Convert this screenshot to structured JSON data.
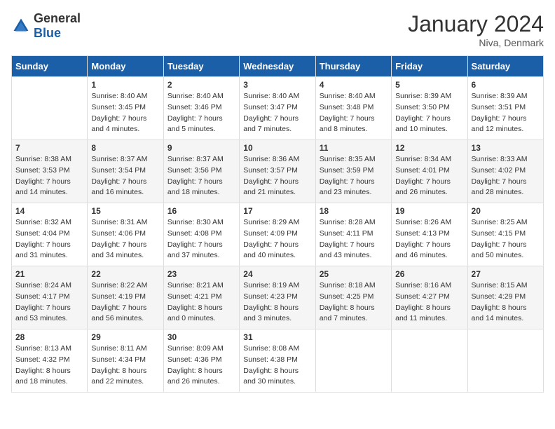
{
  "header": {
    "logo": {
      "general": "General",
      "blue": "Blue"
    },
    "title": "January 2024",
    "location": "Niva, Denmark"
  },
  "days_of_week": [
    "Sunday",
    "Monday",
    "Tuesday",
    "Wednesday",
    "Thursday",
    "Friday",
    "Saturday"
  ],
  "weeks": [
    [
      {
        "day": "",
        "sunrise": "",
        "sunset": "",
        "daylight": ""
      },
      {
        "day": "1",
        "sunrise": "Sunrise: 8:40 AM",
        "sunset": "Sunset: 3:45 PM",
        "daylight": "Daylight: 7 hours and 4 minutes."
      },
      {
        "day": "2",
        "sunrise": "Sunrise: 8:40 AM",
        "sunset": "Sunset: 3:46 PM",
        "daylight": "Daylight: 7 hours and 5 minutes."
      },
      {
        "day": "3",
        "sunrise": "Sunrise: 8:40 AM",
        "sunset": "Sunset: 3:47 PM",
        "daylight": "Daylight: 7 hours and 7 minutes."
      },
      {
        "day": "4",
        "sunrise": "Sunrise: 8:40 AM",
        "sunset": "Sunset: 3:48 PM",
        "daylight": "Daylight: 7 hours and 8 minutes."
      },
      {
        "day": "5",
        "sunrise": "Sunrise: 8:39 AM",
        "sunset": "Sunset: 3:50 PM",
        "daylight": "Daylight: 7 hours and 10 minutes."
      },
      {
        "day": "6",
        "sunrise": "Sunrise: 8:39 AM",
        "sunset": "Sunset: 3:51 PM",
        "daylight": "Daylight: 7 hours and 12 minutes."
      }
    ],
    [
      {
        "day": "7",
        "sunrise": "Sunrise: 8:38 AM",
        "sunset": "Sunset: 3:53 PM",
        "daylight": "Daylight: 7 hours and 14 minutes."
      },
      {
        "day": "8",
        "sunrise": "Sunrise: 8:37 AM",
        "sunset": "Sunset: 3:54 PM",
        "daylight": "Daylight: 7 hours and 16 minutes."
      },
      {
        "day": "9",
        "sunrise": "Sunrise: 8:37 AM",
        "sunset": "Sunset: 3:56 PM",
        "daylight": "Daylight: 7 hours and 18 minutes."
      },
      {
        "day": "10",
        "sunrise": "Sunrise: 8:36 AM",
        "sunset": "Sunset: 3:57 PM",
        "daylight": "Daylight: 7 hours and 21 minutes."
      },
      {
        "day": "11",
        "sunrise": "Sunrise: 8:35 AM",
        "sunset": "Sunset: 3:59 PM",
        "daylight": "Daylight: 7 hours and 23 minutes."
      },
      {
        "day": "12",
        "sunrise": "Sunrise: 8:34 AM",
        "sunset": "Sunset: 4:01 PM",
        "daylight": "Daylight: 7 hours and 26 minutes."
      },
      {
        "day": "13",
        "sunrise": "Sunrise: 8:33 AM",
        "sunset": "Sunset: 4:02 PM",
        "daylight": "Daylight: 7 hours and 28 minutes."
      }
    ],
    [
      {
        "day": "14",
        "sunrise": "Sunrise: 8:32 AM",
        "sunset": "Sunset: 4:04 PM",
        "daylight": "Daylight: 7 hours and 31 minutes."
      },
      {
        "day": "15",
        "sunrise": "Sunrise: 8:31 AM",
        "sunset": "Sunset: 4:06 PM",
        "daylight": "Daylight: 7 hours and 34 minutes."
      },
      {
        "day": "16",
        "sunrise": "Sunrise: 8:30 AM",
        "sunset": "Sunset: 4:08 PM",
        "daylight": "Daylight: 7 hours and 37 minutes."
      },
      {
        "day": "17",
        "sunrise": "Sunrise: 8:29 AM",
        "sunset": "Sunset: 4:09 PM",
        "daylight": "Daylight: 7 hours and 40 minutes."
      },
      {
        "day": "18",
        "sunrise": "Sunrise: 8:28 AM",
        "sunset": "Sunset: 4:11 PM",
        "daylight": "Daylight: 7 hours and 43 minutes."
      },
      {
        "day": "19",
        "sunrise": "Sunrise: 8:26 AM",
        "sunset": "Sunset: 4:13 PM",
        "daylight": "Daylight: 7 hours and 46 minutes."
      },
      {
        "day": "20",
        "sunrise": "Sunrise: 8:25 AM",
        "sunset": "Sunset: 4:15 PM",
        "daylight": "Daylight: 7 hours and 50 minutes."
      }
    ],
    [
      {
        "day": "21",
        "sunrise": "Sunrise: 8:24 AM",
        "sunset": "Sunset: 4:17 PM",
        "daylight": "Daylight: 7 hours and 53 minutes."
      },
      {
        "day": "22",
        "sunrise": "Sunrise: 8:22 AM",
        "sunset": "Sunset: 4:19 PM",
        "daylight": "Daylight: 7 hours and 56 minutes."
      },
      {
        "day": "23",
        "sunrise": "Sunrise: 8:21 AM",
        "sunset": "Sunset: 4:21 PM",
        "daylight": "Daylight: 8 hours and 0 minutes."
      },
      {
        "day": "24",
        "sunrise": "Sunrise: 8:19 AM",
        "sunset": "Sunset: 4:23 PM",
        "daylight": "Daylight: 8 hours and 3 minutes."
      },
      {
        "day": "25",
        "sunrise": "Sunrise: 8:18 AM",
        "sunset": "Sunset: 4:25 PM",
        "daylight": "Daylight: 8 hours and 7 minutes."
      },
      {
        "day": "26",
        "sunrise": "Sunrise: 8:16 AM",
        "sunset": "Sunset: 4:27 PM",
        "daylight": "Daylight: 8 hours and 11 minutes."
      },
      {
        "day": "27",
        "sunrise": "Sunrise: 8:15 AM",
        "sunset": "Sunset: 4:29 PM",
        "daylight": "Daylight: 8 hours and 14 minutes."
      }
    ],
    [
      {
        "day": "28",
        "sunrise": "Sunrise: 8:13 AM",
        "sunset": "Sunset: 4:32 PM",
        "daylight": "Daylight: 8 hours and 18 minutes."
      },
      {
        "day": "29",
        "sunrise": "Sunrise: 8:11 AM",
        "sunset": "Sunset: 4:34 PM",
        "daylight": "Daylight: 8 hours and 22 minutes."
      },
      {
        "day": "30",
        "sunrise": "Sunrise: 8:09 AM",
        "sunset": "Sunset: 4:36 PM",
        "daylight": "Daylight: 8 hours and 26 minutes."
      },
      {
        "day": "31",
        "sunrise": "Sunrise: 8:08 AM",
        "sunset": "Sunset: 4:38 PM",
        "daylight": "Daylight: 8 hours and 30 minutes."
      },
      {
        "day": "",
        "sunrise": "",
        "sunset": "",
        "daylight": ""
      },
      {
        "day": "",
        "sunrise": "",
        "sunset": "",
        "daylight": ""
      },
      {
        "day": "",
        "sunrise": "",
        "sunset": "",
        "daylight": ""
      }
    ]
  ]
}
